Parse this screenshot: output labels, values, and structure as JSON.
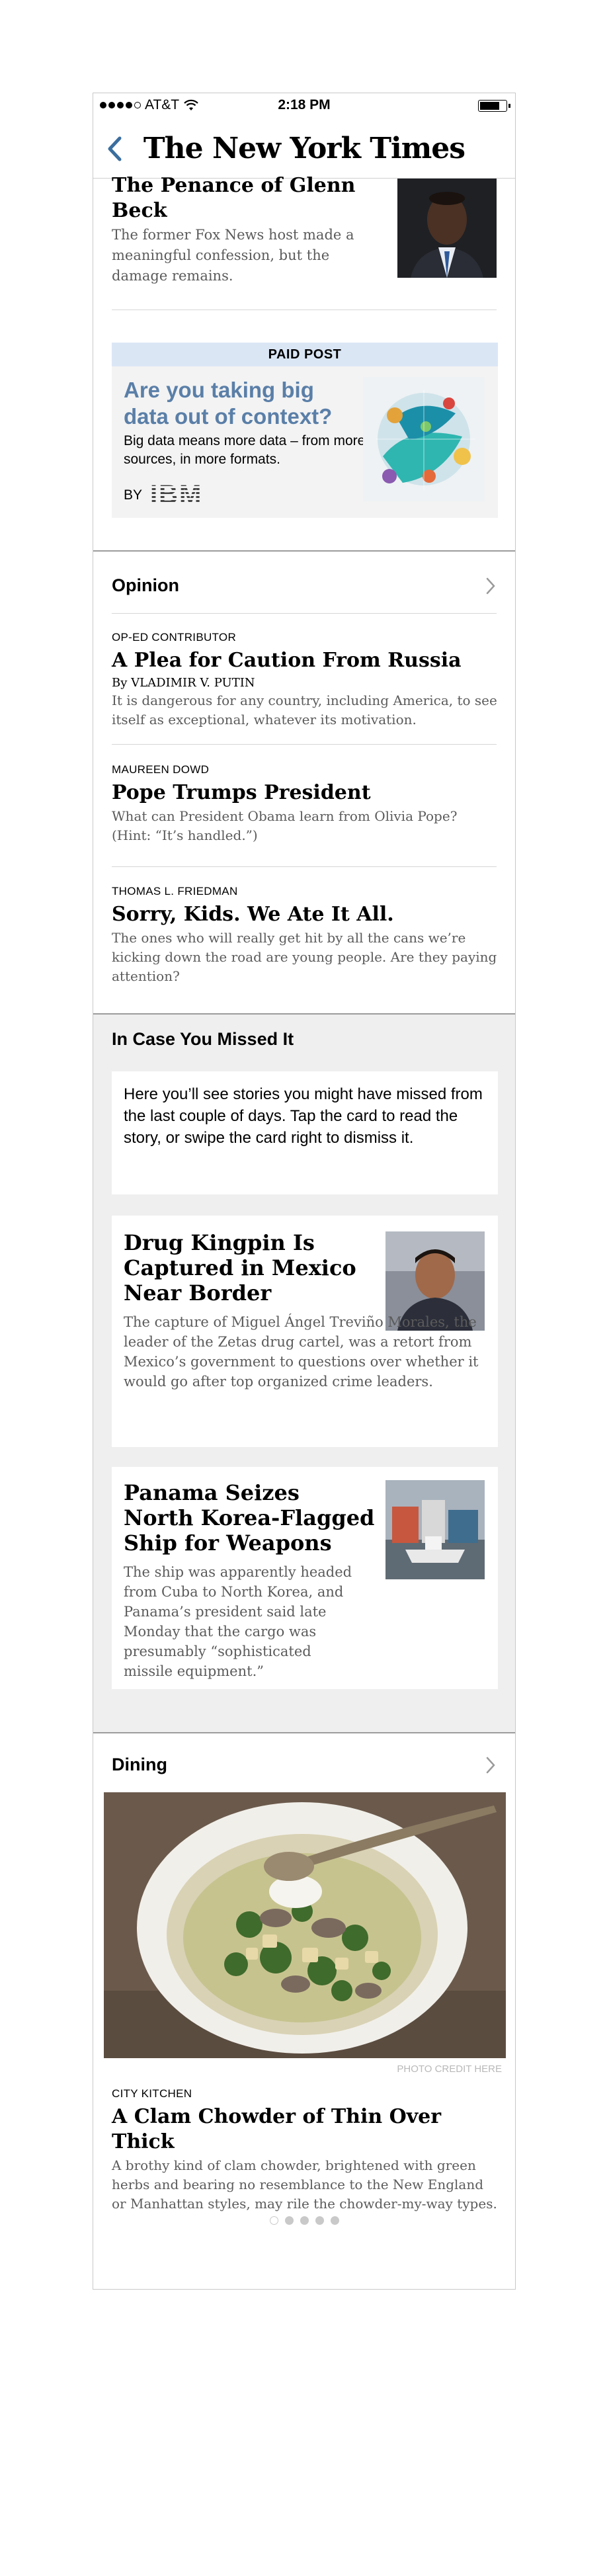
{
  "status_bar": {
    "carrier": "AT&T",
    "time": "2:18 PM",
    "signal_bars_filled": 4,
    "signal_bars_total": 5,
    "battery_level": 0.75
  },
  "navbar": {
    "masthead": "The New York Times",
    "back_icon": "chevron-left-icon"
  },
  "top_story": {
    "title": "The Penance of Glenn Beck",
    "summary": "The former Fox News host made a meaningful confession, but the damage remains."
  },
  "paid_post": {
    "label": "PAID POST",
    "headline": "Are you taking big data out of context?",
    "body": "Big data means more data – from more sources, in more formats.",
    "by": "BY",
    "sponsor": "IBM"
  },
  "opinion": {
    "heading": "Opinion",
    "items": [
      {
        "kicker": "OP-ED CONTRIBUTOR",
        "title": "A Plea for Caution From Russia",
        "byline": "By VLADIMIR V. PUTIN",
        "summary": "It is dangerous for any country, including America, to see itself as exceptional, whatever its motivation."
      },
      {
        "kicker": "MAUREEN DOWD",
        "title": "Pope Trumps President",
        "summary": "What can President Obama learn from Olivia Pope? (Hint: “It’s handled.”)"
      },
      {
        "kicker": "THOMAS L. FRIEDMAN",
        "title": "Sorry, Kids. We Ate It All.",
        "summary": "The ones who will really get hit by all the cans we’re kicking down the road are young people. Are they paying attention?"
      }
    ]
  },
  "icymi": {
    "heading": "In Case You Missed It",
    "intro": "Here you’ll see stories you might have missed from the last couple of days. Tap the card to read the story, or swipe the card right to dismiss it.",
    "cards": [
      {
        "title": "Drug Kingpin Is Captured in Mexico Near Border",
        "summary": "The capture of Miguel Ángel Treviño Morales, the leader of the Zetas drug cartel, was a retort from Mexico’s government to questions over whether it would go after top organized crime leaders."
      },
      {
        "title": "Panama Seizes North Korea-Flagged Ship for Weapons",
        "summary": "The ship was apparently headed from Cuba to North Korea, and Panama’s president said late Monday that the cargo was presumably “sophisticated missile equipment.”"
      }
    ]
  },
  "dining": {
    "heading": "Dining",
    "photo_credit": "PHOTO CREDIT HERE",
    "kicker": "CITY KITCHEN",
    "title": "A Clam Chowder of Thin Over Thick",
    "summary": "A brothy kind of clam chowder, brightened with green herbs and bearing no resemblance to the New England or Manhattan styles, may rile the chowder-my-way types.",
    "pager_total": 5,
    "pager_active": 1
  },
  "colors": {
    "accent_blue": "#3b6e9e",
    "paid_headline": "#5a7fa8",
    "paid_bar": "#dbe6f5",
    "icymi_bg": "#efefef",
    "summary_gray": "#5b5b5b"
  }
}
